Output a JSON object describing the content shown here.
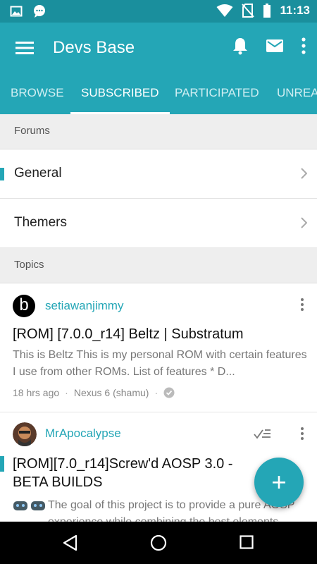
{
  "status_bar": {
    "time": "11:13",
    "left_icons": [
      "image-icon",
      "chat-bubble-icon"
    ],
    "right_icons": [
      "wifi-icon",
      "no-sim-icon",
      "battery-icon"
    ]
  },
  "app_bar": {
    "title": "Devs Base",
    "icons": [
      "menu-icon",
      "bell-icon",
      "mail-icon",
      "more-vert-icon"
    ]
  },
  "tabs": [
    {
      "label": "BROWSE",
      "active": false
    },
    {
      "label": "SUBSCRIBED",
      "active": true
    },
    {
      "label": "PARTICIPATED",
      "active": false
    },
    {
      "label": "UNREAD",
      "active": false
    }
  ],
  "forums": {
    "header": "Forums",
    "items": [
      {
        "label": "General",
        "highlighted": true
      },
      {
        "label": "Themers",
        "highlighted": false
      }
    ]
  },
  "topics": {
    "header": "Topics",
    "items": [
      {
        "author": "setiawanjimmy",
        "avatar_letter": "b",
        "title": "[ROM] [7.0.0_r14] Beltz | Substratum",
        "excerpt": "This is Beltz This is my personal ROM with certain features I use from other ROMs. List of features * D...",
        "time": "18 hrs ago",
        "device": "Nexus 6 (shamu)"
      },
      {
        "author": "MrApocalypse",
        "title": "[ROM][7.0_r14]Screw'd AOSP 3.0 - BETA BUILDS",
        "excerpt": "The goal of this project is to provide a pure AOSP experience while combining the best elements"
      }
    ]
  },
  "fab": {
    "icon": "plus-icon"
  },
  "nav_bar": {
    "icons": [
      "back-icon",
      "home-icon",
      "recents-icon"
    ]
  },
  "colors": {
    "primary": "#24a6b6",
    "status_bar": "#1a8f9d",
    "section_bg": "#eeeeee"
  }
}
